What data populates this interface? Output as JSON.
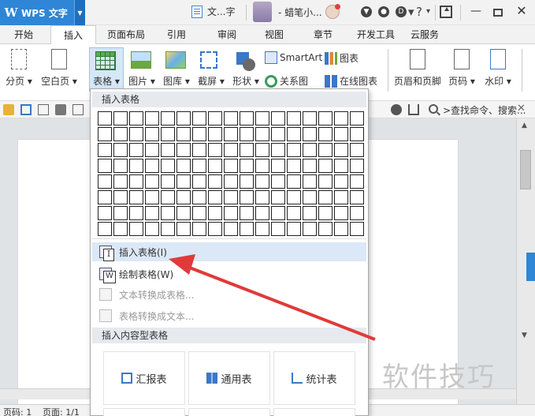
{
  "titlebar": {
    "app_name": "WPS 文字",
    "app_logo": "W",
    "doc_tab": "文...字",
    "user_name": "- 蜡笔小...",
    "window_min": "—",
    "window_close": "✕"
  },
  "tabs": [
    "开始",
    "插入",
    "页面布局",
    "引用",
    "审阅",
    "视图",
    "章节",
    "开发工具",
    "云服务"
  ],
  "active_tab": "插入",
  "ribbon": {
    "page_break": "分页",
    "blank_page": "空白页",
    "table": "表格",
    "picture": "图片",
    "gallery": "图库",
    "screenshot": "截屏",
    "shapes": "形状",
    "smartart": "SmartArt",
    "chart": "图表",
    "relation": "关系图",
    "online_chart": "在线图表",
    "header_footer": "页眉和页脚",
    "page_number": "页码",
    "watermark": "水印"
  },
  "search": {
    "text": ">查找命令、搜索..."
  },
  "dropdown": {
    "insert_table_header": "插入表格",
    "grid_cols": 17,
    "grid_rows": 8,
    "items": [
      {
        "label": "插入表格(I)",
        "enabled": true
      },
      {
        "label": "绘制表格(W)",
        "enabled": true
      },
      {
        "label": "文本转换成表格...",
        "enabled": false
      },
      {
        "label": "表格转换成文本...",
        "enabled": false
      }
    ],
    "content_table_header": "插入内容型表格",
    "cards": [
      {
        "label": "汇报表",
        "icon": "edit-icon"
      },
      {
        "label": "通用表",
        "icon": "grid-icon"
      },
      {
        "label": "统计表",
        "icon": "chart-icon"
      }
    ]
  },
  "statusbar": {
    "page": "页码: 1",
    "pages": "页面: 1/1"
  },
  "watermark_text": "软件技巧",
  "colors": {
    "accent": "#2f86d6",
    "arrow": "#e03a3a",
    "highlight": "#dbe8f7"
  }
}
